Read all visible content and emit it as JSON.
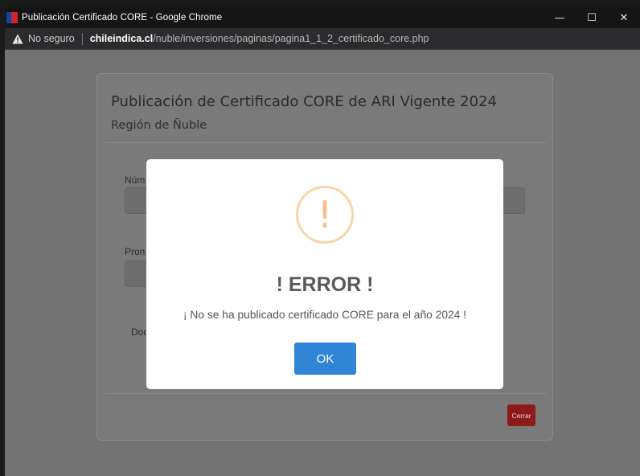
{
  "window": {
    "title": "Publicación Certificado CORE - Google Chrome",
    "controls": {
      "minimize": "—",
      "maximize": "☐",
      "close": "✕"
    }
  },
  "addressbar": {
    "security_label": "No seguro",
    "host": "chileindica.cl",
    "path": "/nuble/inversiones/paginas/pagina1_1_2_certificado_core.php"
  },
  "page": {
    "title": "Publicación de Certificado CORE de ARI Vigente 2024",
    "subtitle": "Región de Ñuble",
    "field1_label": "Núm",
    "field2_label": "Pron",
    "field3_label": "Doc",
    "close_button": "Cerrar"
  },
  "modal": {
    "icon": "warning-icon",
    "icon_glyph": "!",
    "title": "! ERROR !",
    "message": "¡ No se ha publicado certificado CORE para el año 2024 !",
    "ok_button": "OK"
  },
  "colors": {
    "ok_button": "#3085d6",
    "warning_icon": "#f8bb86",
    "close_button": "#8c1a1a",
    "overlay": "#737373"
  }
}
